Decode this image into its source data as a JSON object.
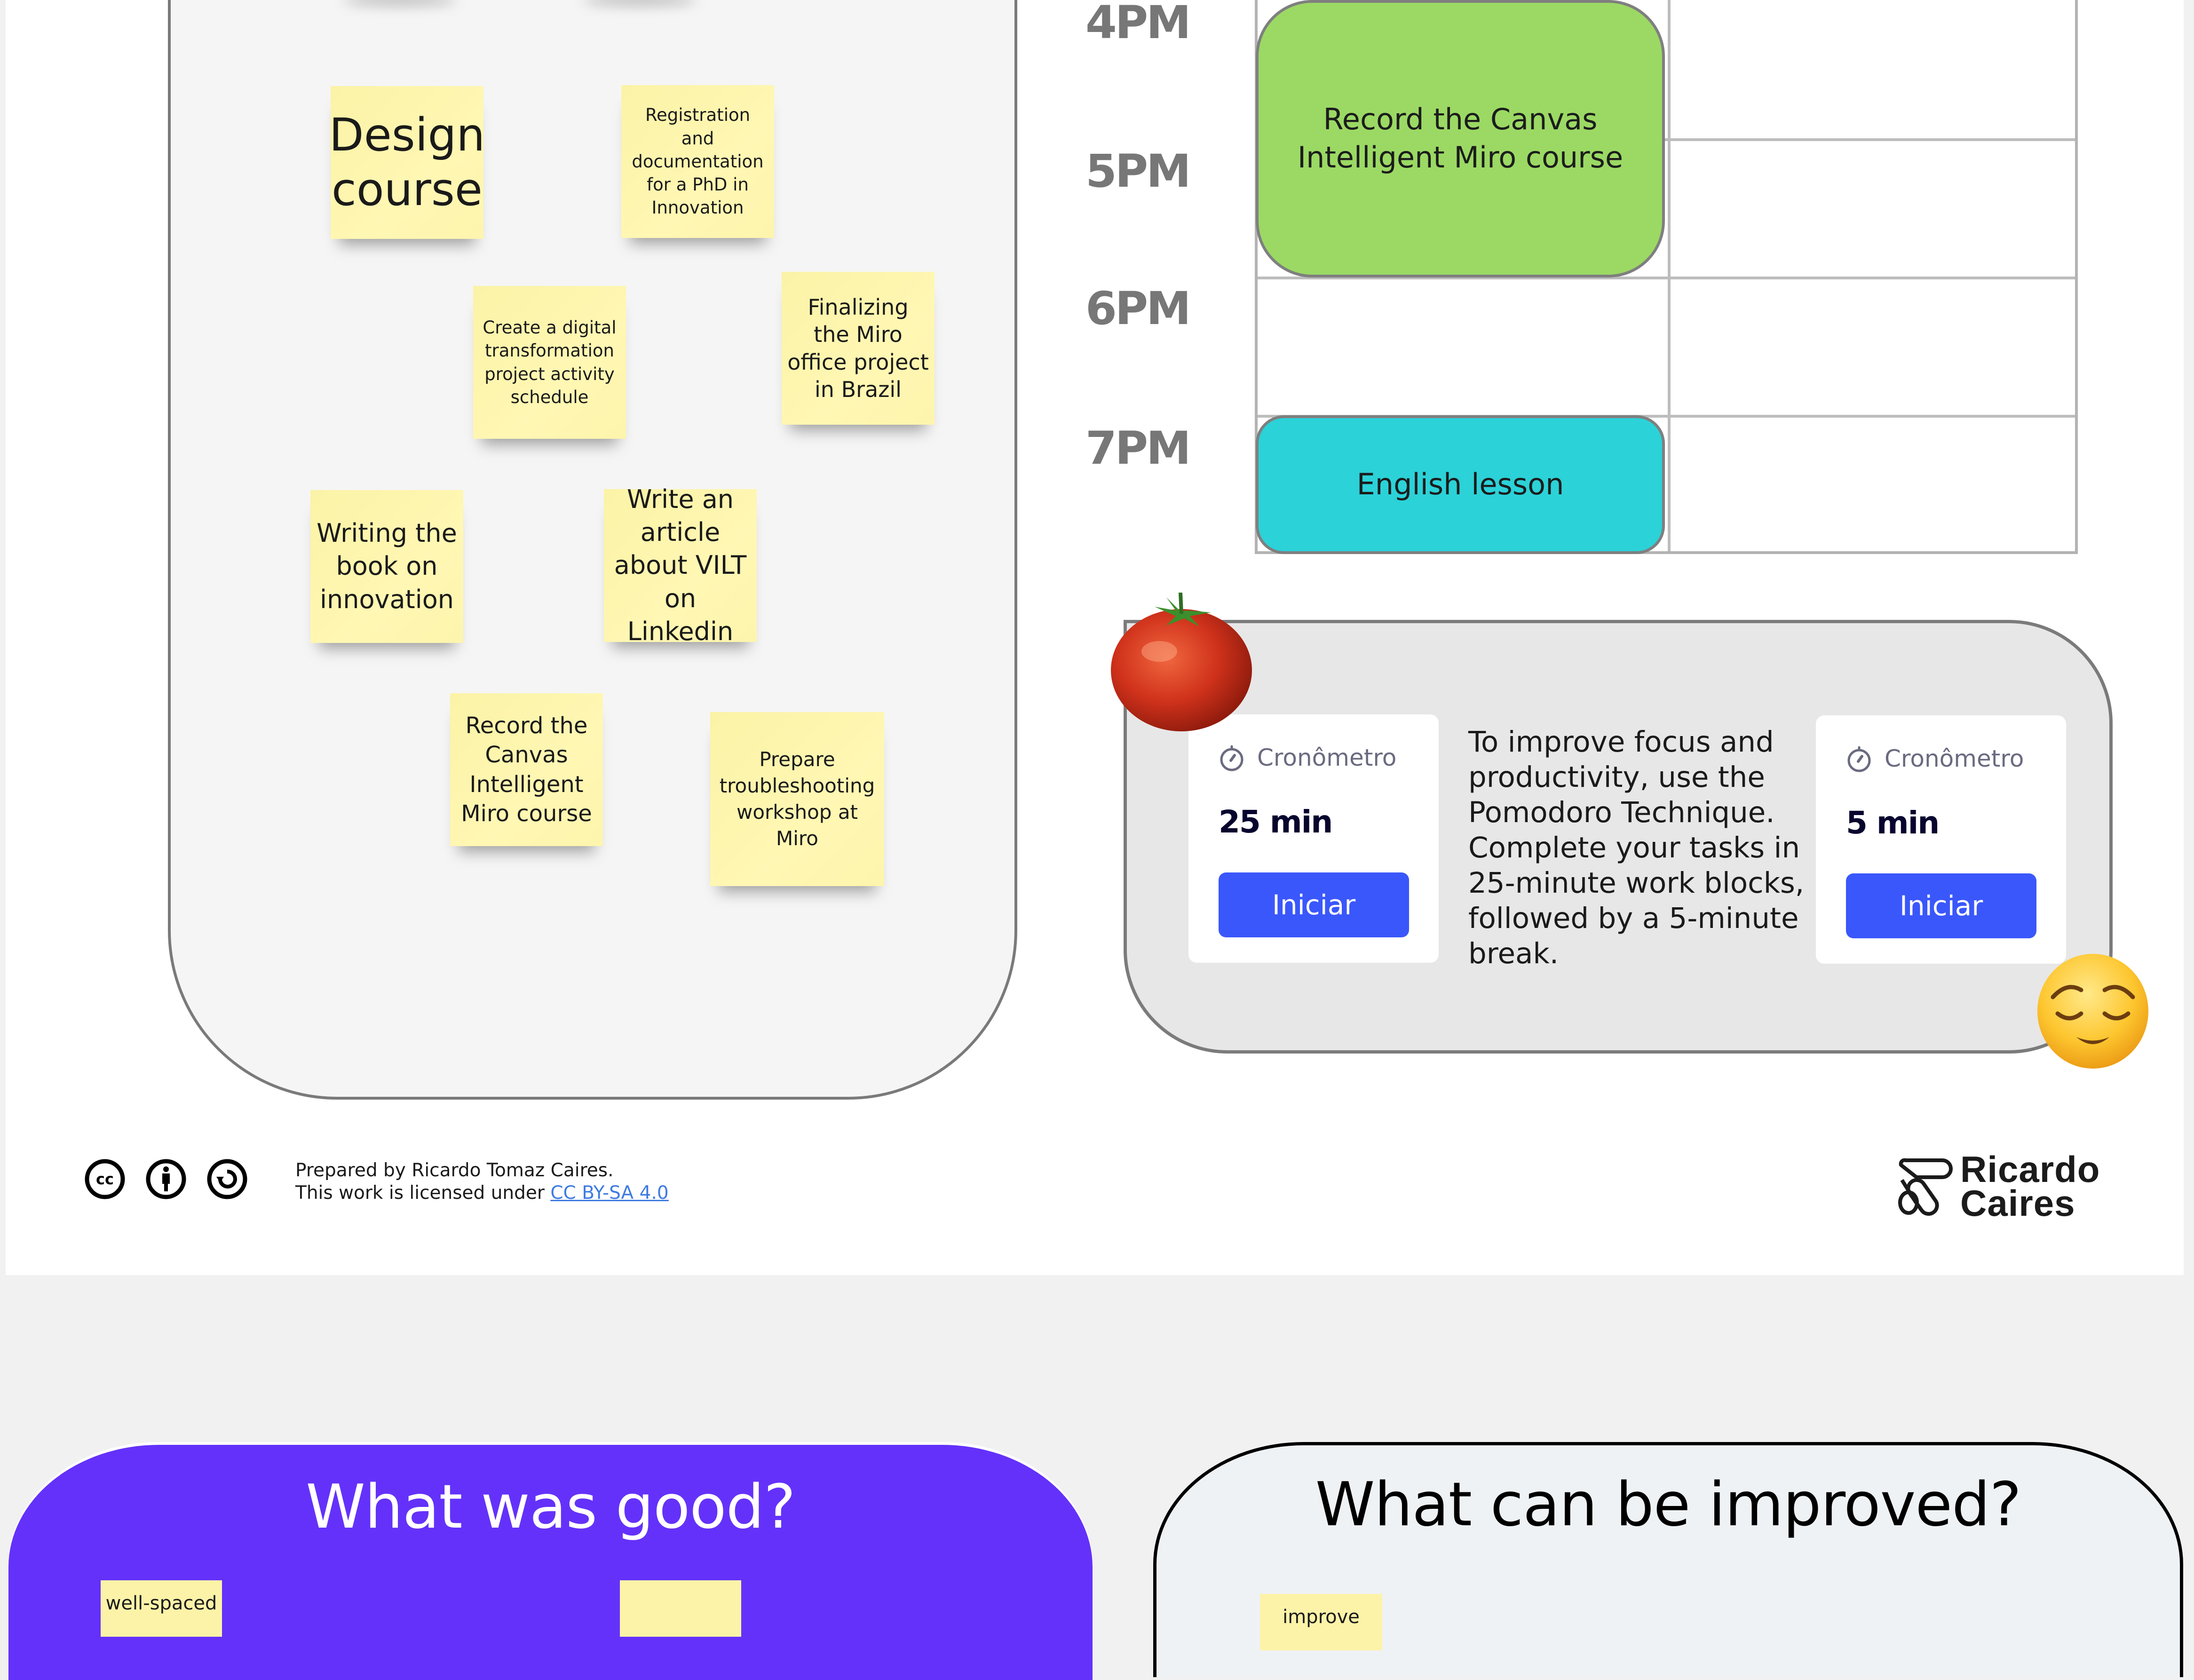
{
  "task_board": {
    "stickies": [
      {
        "text": "Design course"
      },
      {
        "text": "Registration and documentation for a PhD in Innovation"
      },
      {
        "text": "Create a digital transformation project activity schedule"
      },
      {
        "text": "Finalizing the Miro office project in Brazil"
      },
      {
        "text": "Writing the book on innovation"
      },
      {
        "text": "Write an article about VILT on Linkedin"
      },
      {
        "text": "Record the Canvas Intelligent Miro course"
      },
      {
        "text": "Prepare troubleshooting workshop at Miro"
      }
    ]
  },
  "schedule": {
    "time_labels": [
      "4PM",
      "5PM",
      "6PM",
      "7PM"
    ],
    "events": [
      {
        "title": "Record the Canvas Intelligent Miro course",
        "color": "#9bd964"
      },
      {
        "title": "English lesson",
        "color": "#2bd2d8"
      }
    ]
  },
  "pomodoro": {
    "timers": [
      {
        "label": "Cronômetro",
        "value": "25 min",
        "button": "Iniciar",
        "icon": "stopwatch-icon"
      },
      {
        "label": "Cronômetro",
        "value": "5 min",
        "button": "Iniciar",
        "icon": "stopwatch-icon"
      }
    ],
    "description": "To improve focus and productivity, use the Pomodoro Technique. Complete your tasks in 25-minute work blocks, followed by a 5-minute break.",
    "emojis": {
      "tomato": "tomato-emoji",
      "relieved": "relieved-face-emoji"
    },
    "accent_color": "#3a57fb"
  },
  "footer": {
    "license_icons": [
      "cc-icon",
      "attribution-icon",
      "share-alike-icon"
    ],
    "prepared_by": "Prepared by Ricardo Tomaz Caires.",
    "license_prefix": "This work is licensed under ",
    "license_link": "CC BY-SA 4.0",
    "logo_line1": "Ricardo",
    "logo_line2": "Caires"
  },
  "retrospective": {
    "good": {
      "title": "What was good?",
      "color": "#6431fa",
      "stickies": [
        {
          "text": "well-spaced"
        },
        {
          "text": ""
        }
      ]
    },
    "improve": {
      "title": "What can be improved?",
      "stickies": [
        {
          "text": "improve"
        }
      ]
    }
  }
}
